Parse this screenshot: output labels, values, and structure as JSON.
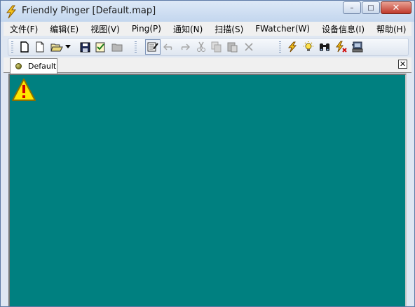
{
  "window": {
    "title": "Friendly Pinger [Default.map]",
    "controls": {
      "minimize": "–",
      "maximize": "□",
      "close": "✕"
    }
  },
  "menu": [
    {
      "label": "文件(F)"
    },
    {
      "label": "编辑(E)"
    },
    {
      "label": "视图(V)"
    },
    {
      "label": "Ping(P)"
    },
    {
      "label": "通知(N)"
    },
    {
      "label": "扫描(S)"
    },
    {
      "label": "FWatcher(W)"
    },
    {
      "label": "设备信息(I)"
    },
    {
      "label": "帮助(H)"
    }
  ],
  "toolbar": {
    "icons": [
      "new-map-icon",
      "new-page-icon",
      "open-folder-icon",
      "dropdown-arrow-icon",
      "save-icon",
      "checklist-icon",
      "folder-icon",
      "edit-mode-icon",
      "undo-icon",
      "redo-icon",
      "cut-icon",
      "copy-icon",
      "paste-icon",
      "delete-icon",
      "ping-lightning-icon",
      "notify-bulb-icon",
      "find-binoculars-icon",
      "fwatcher-icon",
      "device-info-icon"
    ]
  },
  "tabs": {
    "active": "Default",
    "close": "✕"
  },
  "map": {
    "background": "#008080",
    "alert_icon": "warning-icon"
  },
  "colors": {
    "map_bg": "#008080",
    "accent": "#5d7aa6"
  }
}
